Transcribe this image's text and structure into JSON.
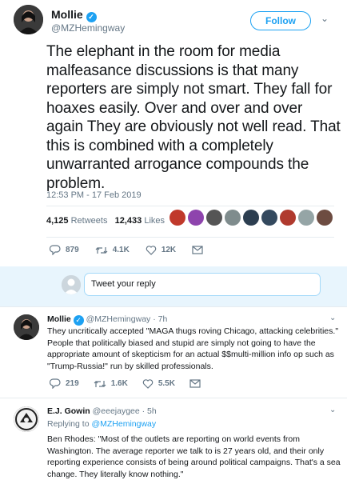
{
  "main_tweet": {
    "name": "Mollie",
    "handle": "@MZHemingway",
    "follow_label": "Follow",
    "text": "The elephant in the room for media malfeasance discussions is that many reporters are simply not smart. They fall for hoaxes easily. Over and over and over again They are obviously not well read. That this is combined with a completely unwarranted arrogance compounds the problem.",
    "timestamp": "12:53 PM - 17 Feb 2019",
    "retweets_count": "4,125",
    "retweets_label": "Retweets",
    "likes_count": "12,433",
    "likes_label": "Likes",
    "actions": {
      "replies": "879",
      "retweets": "4.1K",
      "likes": "12K"
    }
  },
  "reply_box": {
    "placeholder": "Tweet your reply"
  },
  "replies": [
    {
      "name": "Mollie",
      "handle_time": "@MZHemingway · 7h",
      "text": "They uncritically accepted \"MAGA thugs roving Chicago, attacking celebrities.\" People that politically biased and stupid are simply not going to have the appropriate amount of skepticism for an actual $$multi-million info op such as \"Trump-Russia!\" run by skilled professionals.",
      "actions": {
        "replies": "219",
        "retweets": "1.6K",
        "likes": "5.5K"
      }
    },
    {
      "name": "E.J. Gowin",
      "handle_time": "@eeejaygee · 5h",
      "replying_prefix": "Replying to",
      "replying_to": "@MZHemingway",
      "text": "Ben Rhodes: \"Most of the outlets are reporting on world events from Washington. The average reporter we talk to is 27 years old, and their only reporting experience consists of being around political campaigns. That's a sea change. They literally know nothing.\""
    }
  ],
  "colors": {
    "accent": "#1da1f2",
    "secondary_text": "#657786",
    "divider": "#e6ecf0",
    "reply_box_bg": "#e8f5fd"
  }
}
